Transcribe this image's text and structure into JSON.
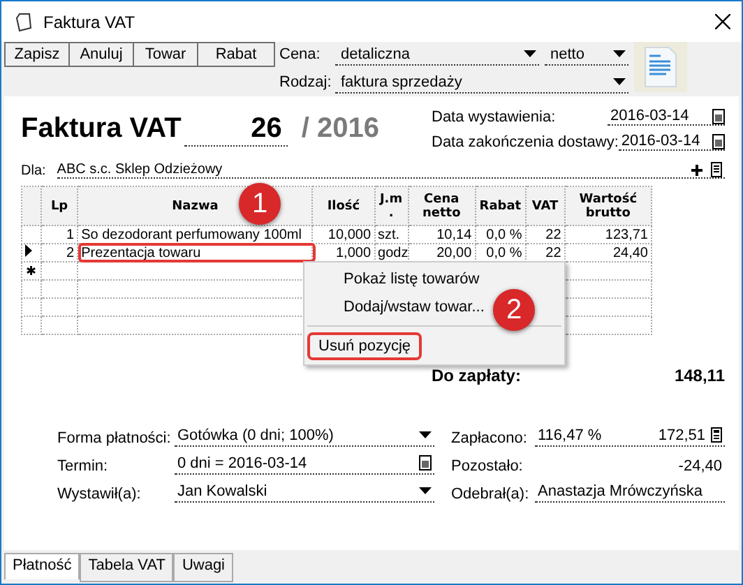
{
  "window": {
    "title": "Faktura VAT"
  },
  "toolbar": {
    "buttons": [
      "Zapisz",
      "Anuluj",
      "Towar",
      "Rabat"
    ]
  },
  "price": {
    "label": "Cena:",
    "value": "detaliczna",
    "mode": "netto"
  },
  "type": {
    "label": "Rodzaj:",
    "value": "faktura sprzedaży"
  },
  "document": {
    "title": "Faktura VAT",
    "number": "26",
    "year": "/ 2016"
  },
  "dates": [
    {
      "label": "Data wystawienia:",
      "value": "2016-03-14"
    },
    {
      "label": "Data zakończenia dostawy:",
      "value": "2016-03-14"
    }
  ],
  "recipient": {
    "label": "Dla:",
    "value": "ABC s.c. Sklep Odzieżowy"
  },
  "table": {
    "columns": [
      "Lp",
      "Nazwa",
      "Ilość",
      "J.m\n.",
      "Cena\nnetto",
      "Rabat",
      "VAT",
      "Wartość\nbrutto"
    ],
    "rows": [
      {
        "current": false,
        "highlighted": false,
        "cells": [
          "1",
          "So dezodorant perfumowany 100ml",
          "10,000",
          "szt.",
          "10,14",
          "0,0 %",
          "22",
          "123,71"
        ]
      },
      {
        "current": true,
        "highlighted": true,
        "cells": [
          "2",
          "Prezentacja towaru",
          "1,000",
          "godz",
          "20,00",
          "0,0 %",
          "22",
          "24,40"
        ]
      }
    ],
    "new_row_marker": "✱"
  },
  "context_menu": [
    {
      "label": "Pokaż listę towarów",
      "highlighted": false
    },
    {
      "label": "Dodaj/wstaw towar...",
      "highlighted": false
    },
    {
      "label": "Usuń pozycję",
      "highlighted": true
    }
  ],
  "badges": [
    "1",
    "2"
  ],
  "total": {
    "label": "Do zapłaty:",
    "value": "148,11"
  },
  "payment": {
    "method_label": "Forma płatności:",
    "method": "Gotówka (0 dni; 100%)",
    "term_label": "Termin:",
    "term": "0 dni = 2016-03-14",
    "issuer_label": "Wystawił(a):",
    "issuer": "Jan Kowalski",
    "paid_label": "Zapłacono:",
    "paid_percent": "116,47 %",
    "paid": "172,51",
    "remaining_label": "Pozostało:",
    "remaining": "-24,40",
    "receiver_label": "Odebrał(a):",
    "receiver": "Anastazja Mrówczyńska"
  },
  "tabs": [
    {
      "label": "Płatność",
      "selected": true
    },
    {
      "label": "Tabela VAT",
      "selected": false
    },
    {
      "label": "Uwagi",
      "selected": false
    }
  ]
}
